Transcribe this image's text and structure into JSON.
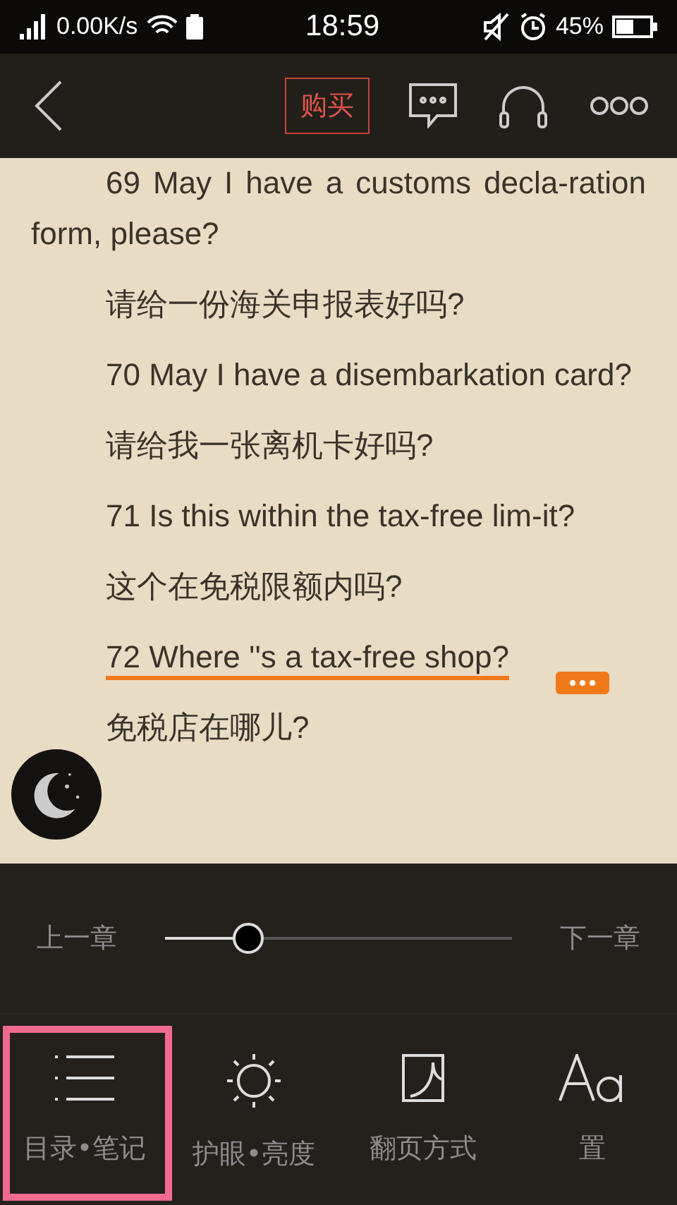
{
  "status_bar": {
    "network_speed": "0.00K/s",
    "time": "18:59",
    "battery": "45%"
  },
  "toolbar": {
    "buy_button": "购买"
  },
  "paragraphs": [
    {
      "text": "69 May I have a customs decla-ration form, please?",
      "highlighted": false
    },
    {
      "text": "请给一份海关申报表好吗?",
      "highlighted": false
    },
    {
      "text": "70 May I have a disembarkation card?",
      "highlighted": false
    },
    {
      "text": "请给我一张离机卡好吗?",
      "highlighted": false
    },
    {
      "text": "71 Is this within the tax-free lim-it?",
      "highlighted": false
    },
    {
      "text": "这个在免税限额内吗?",
      "highlighted": false
    },
    {
      "text": "72 Where ''s a tax-free shop?",
      "highlighted": true
    },
    {
      "text": "免税店在哪儿?",
      "highlighted": false
    }
  ],
  "chapter_nav": {
    "prev": "上一章",
    "next": "下一章",
    "level": 0.24
  },
  "menu": [
    {
      "kind": "list",
      "label": "目录•笔记",
      "highlighted": true
    },
    {
      "kind": "brightness",
      "label": "护眼•亮度",
      "highlighted": false
    },
    {
      "kind": "page",
      "label": "翻页方式",
      "highlighted": false
    },
    {
      "kind": "font",
      "label": "置",
      "highlighted": false
    }
  ]
}
